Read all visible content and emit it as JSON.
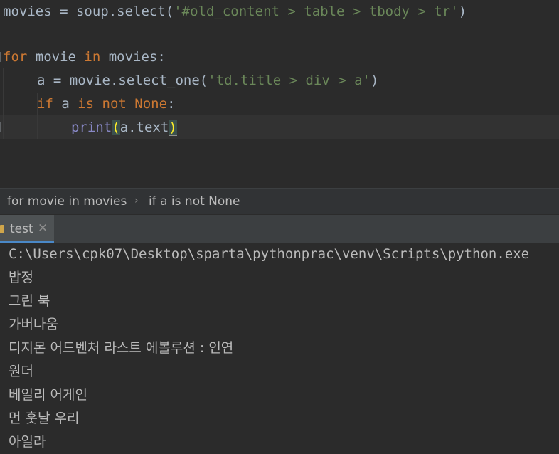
{
  "editor": {
    "line1": {
      "var": "movies",
      "assign": " = soup.select(",
      "str": "'#old_content > table > tbody > tr'",
      "end": ")"
    },
    "line3": {
      "kw1": "for",
      "mid": " movie ",
      "kw2": "in",
      "end": " movies:"
    },
    "line4": {
      "pre": "a = movie.select_one(",
      "str": "'td.title > div > a'",
      "end": ")"
    },
    "line5": {
      "kw1": "if",
      "mid": " a ",
      "kw2": "is not None",
      "end": ":"
    },
    "line6": {
      "fn": "print",
      "lparen": "(",
      "arg": "a.text",
      "rparen": ")"
    }
  },
  "breadcrumb": {
    "items": [
      "for movie in movies",
      "if a is not None"
    ],
    "separator": "›"
  },
  "run": {
    "tab_label": "test",
    "close_glyph": "✕"
  },
  "console": {
    "lines": [
      "C:\\Users\\cpk07\\Desktop\\sparta\\pythonprac\\venv\\Scripts\\python.exe",
      "밥정",
      "그린 북",
      "가버나움",
      "디지몬 어드벤처 라스트 에볼루션 : 인연",
      "원더",
      "베일리 어게인",
      "먼 훗날 우리",
      "아일라"
    ]
  },
  "colors": {
    "background": "#2b2b2b",
    "keyword": "#cc7832",
    "string": "#6a8759",
    "builtin": "#8888c6",
    "text": "#a9b7c6",
    "brace_highlight": "#ffef28"
  }
}
